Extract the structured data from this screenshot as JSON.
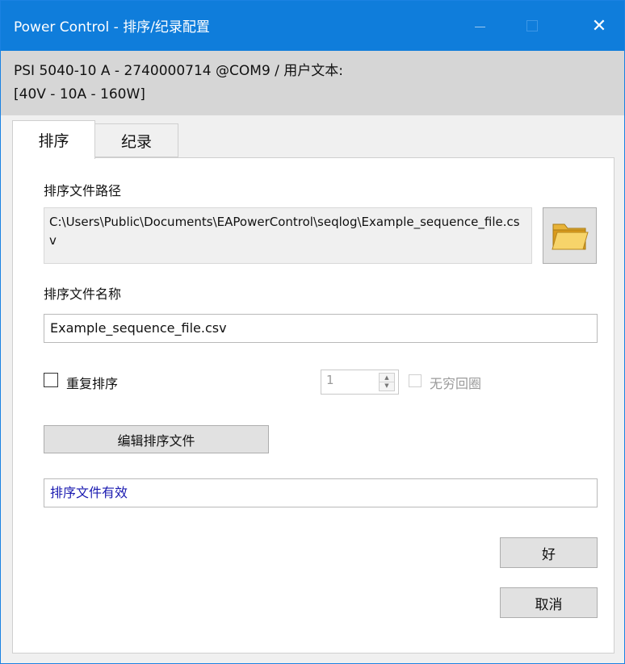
{
  "window": {
    "title": "Power Control - 排序/纪录配置",
    "close_glyph": "✕"
  },
  "header": {
    "device_line": "PSI 5040-10 A - 2740000714 @COM9 / 用户文本:",
    "spec_line": "[40V - 10A - 160W]"
  },
  "tabs": [
    {
      "label": "排序",
      "active": true
    },
    {
      "label": "纪录",
      "active": false
    }
  ],
  "sequence": {
    "path_label": "排序文件路径",
    "path_value": "C:\\Users\\Public\\Documents\\EAPowerControl\\seqlog\\Example_sequence_file.csv",
    "name_label": "排序文件名称",
    "name_value": "Example_sequence_file.csv",
    "repeat_label": "重复排序",
    "repeat_count": "1",
    "infinite_label": "无穷回圈",
    "edit_button": "编辑排序文件",
    "status_text": "排序文件有效"
  },
  "buttons": {
    "ok": "好",
    "cancel": "取消"
  },
  "colors": {
    "titlebar": "#0f7ddb",
    "header": "#d6d6d6",
    "status_text": "#1a1ab0"
  }
}
